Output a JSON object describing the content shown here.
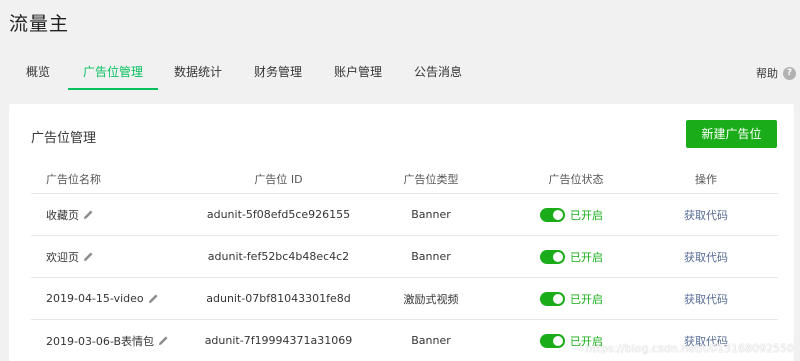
{
  "app": {
    "title": "流量主"
  },
  "tabs": [
    {
      "label": "概览"
    },
    {
      "label": "广告位管理"
    },
    {
      "label": "数据统计"
    },
    {
      "label": "财务管理"
    },
    {
      "label": "账户管理"
    },
    {
      "label": "公告消息"
    }
  ],
  "help": {
    "label": "帮助",
    "icon": "help-circle-icon",
    "glyph": "?"
  },
  "panel": {
    "title": "广告位管理",
    "create_button": "新建广告位"
  },
  "table": {
    "columns": [
      "广告位名称",
      "广告位 ID",
      "广告位类型",
      "广告位状态",
      "操作"
    ],
    "rows": [
      {
        "name": "收藏页",
        "id": "adunit-5f08efd5ce926155",
        "type": "Banner",
        "status": "已开启",
        "action": "获取代码"
      },
      {
        "name": "欢迎页",
        "id": "adunit-fef52bc4b48ec4c2",
        "type": "Banner",
        "status": "已开启",
        "action": "获取代码"
      },
      {
        "name": "2019-04-15-video",
        "id": "adunit-07bf81043301fe8d",
        "type": "激励式视频",
        "status": "已开启",
        "action": "获取代码"
      },
      {
        "name": "2019-03-06-B表情包",
        "id": "adunit-7f19994371a31069",
        "type": "Banner",
        "status": "已开启",
        "action": "获取代码"
      }
    ]
  },
  "colors": {
    "accent": "#07c160",
    "button": "#1aad19",
    "link": "#576b95"
  },
  "watermark": "https://blog.csdn.net/u013168092550"
}
